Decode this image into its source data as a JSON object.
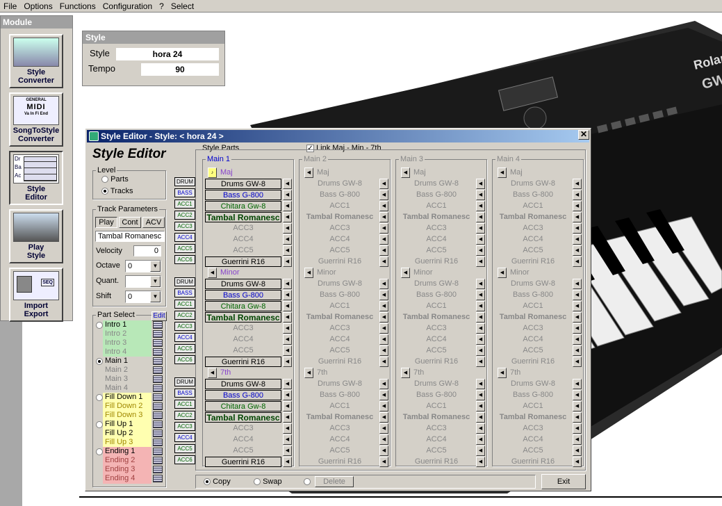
{
  "menu": [
    "File",
    "Options",
    "Functions",
    "Configuration",
    "?",
    "Select"
  ],
  "module": {
    "title": "Module",
    "buttons": [
      {
        "l1": "Style",
        "l2": "Converter"
      },
      {
        "l1": "SongToStyle",
        "l2": "Converter"
      },
      {
        "l1": "Style",
        "l2": "Editor"
      },
      {
        "l1": "Play",
        "l2": "Style"
      },
      {
        "l1": "Import",
        "l2": "Export"
      }
    ],
    "icon_texts": {
      "midi_general": "GENERAL",
      "midi": "MIDI",
      "val": "Va In Fi End",
      "seq": "SEQ",
      "dr": "Dr",
      "ba": "Ba",
      "ac": "Ac"
    }
  },
  "stylebox": {
    "title": "Style",
    "style_label": "Style",
    "style_value": "hora 24",
    "tempo_label": "Tempo",
    "tempo_value": "90"
  },
  "photo": {
    "brand": "Rolan",
    "model": "GW"
  },
  "editor": {
    "title": "Style Editor - Style:  < hora 24 >",
    "heading": "Style Editor",
    "level": {
      "title": "Level",
      "parts": "Parts",
      "tracks": "Tracks"
    },
    "track_params": {
      "title": "Track Parameters",
      "tabs": [
        "Play",
        "Cont",
        "ACV"
      ],
      "instrument": "Tambal Romanesc",
      "velocity_label": "Velocity",
      "velocity": "0",
      "octave_label": "Octave",
      "octave": "0",
      "quant_label": "Quant.",
      "quant": "",
      "shift_label": "Shift",
      "shift": "0"
    },
    "part_select": {
      "title": "Part Select",
      "edit": "Edit",
      "intro": [
        "Intro 1",
        "Intro 2",
        "Intro 3",
        "Intro 4"
      ],
      "main": [
        "Main 1",
        "Main 2",
        "Main 3",
        "Main 4"
      ],
      "filldown": [
        "Fill Down 1",
        "Fill Down 2",
        "Fill Down 3"
      ],
      "fillup": [
        "Fill Up 1",
        "Fill Up 2",
        "Fill Up 3"
      ],
      "ending": [
        "Ending 1",
        "Ending 2",
        "Ending 3",
        "Ending 4"
      ]
    },
    "style_parts_title": "Style Parts",
    "link_label": "Link Maj - Min - 7th",
    "tags": [
      "DRUM",
      "BASS",
      "ACC1",
      "ACC2",
      "ACC3",
      "ACC4",
      "ACC5",
      "ACC6"
    ],
    "sections": [
      "Maj",
      "Minor",
      "7th"
    ],
    "tracks": [
      "Drums GW-8",
      "Bass G-800",
      "Chitara Gw-8",
      "Tambal Romanesc",
      "ACC3",
      "ACC4",
      "ACC5",
      "Guerrini R16"
    ],
    "accs": [
      "Drums GW-8",
      "Bass G-800",
      "ACC1",
      "Tambal Romanesc",
      "ACC3",
      "ACC4",
      "ACC5",
      "Guerrini R16"
    ],
    "mains": [
      "Main 1",
      "Main 2",
      "Main 3",
      "Main 4"
    ],
    "footer": {
      "copy": "Copy",
      "swap": "Swap",
      "delete": "Delete",
      "exit": "Exit"
    }
  }
}
